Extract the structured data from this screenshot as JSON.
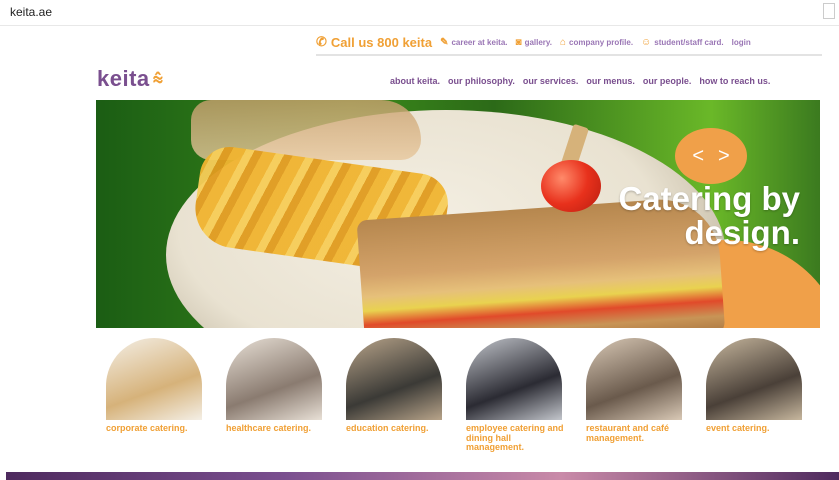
{
  "browser": {
    "url": "keita.ae"
  },
  "utility": {
    "call": "Call us 800 keita",
    "items": [
      {
        "icon": "document-icon",
        "glyph": "✎",
        "label": "career at keita."
      },
      {
        "icon": "camera-icon",
        "glyph": "◙",
        "label": "gallery."
      },
      {
        "icon": "hat-icon",
        "glyph": "⌂",
        "label": "company profile."
      },
      {
        "icon": "smiley-icon",
        "glyph": "☺",
        "label": "student/staff card."
      }
    ],
    "login": "login"
  },
  "brand": {
    "name": "keita",
    "accent": "#f0a035",
    "purple": "#7a4f8f"
  },
  "nav": [
    "about keita.",
    "our philosophy.",
    "our services.",
    "our menus.",
    "our people.",
    "how to reach us."
  ],
  "hero": {
    "line1": "Catering by",
    "line2": "design.",
    "prev": "<",
    "next": ">"
  },
  "services": [
    {
      "label": "corporate catering.",
      "c1": "#d6b27a",
      "c2": "#f4efe6"
    },
    {
      "label": "healthcare catering.",
      "c1": "#8a7b70",
      "c2": "#e8e0d6"
    },
    {
      "label": "education catering.",
      "c1": "#3b3a36",
      "c2": "#b8a48a"
    },
    {
      "label": "employee catering and dining hall management.",
      "c1": "#2b2b33",
      "c2": "#c3c6cc"
    },
    {
      "label": "restaurant and café management.",
      "c1": "#6a5a4c",
      "c2": "#d9c9b6"
    },
    {
      "label": "event catering.",
      "c1": "#4a4038",
      "c2": "#c7b79e"
    }
  ]
}
